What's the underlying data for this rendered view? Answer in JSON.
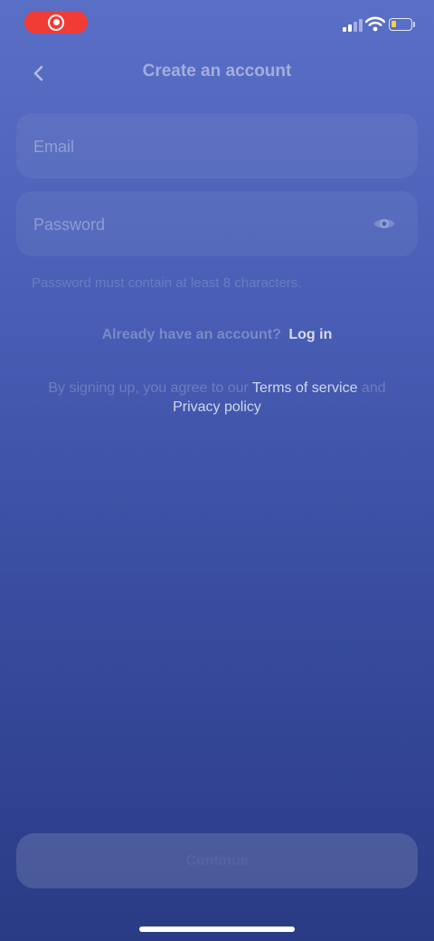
{
  "status_bar": {
    "recording_icon": "screen-record-icon",
    "signal_icon": "cellular-signal-icon",
    "wifi_icon": "wifi-icon",
    "battery_icon": "battery-icon",
    "battery_level": 0.2,
    "colors": {
      "record": "#f03c34",
      "battery_fill": "#f6d33e"
    }
  },
  "header": {
    "back_icon": "chevron-left-icon",
    "title": "Create an account"
  },
  "form": {
    "email": {
      "value": "",
      "placeholder": "Email"
    },
    "password": {
      "value": "",
      "placeholder": "Password",
      "toggle_icon": "eye-icon"
    },
    "hint": "Password must contain at least 8 characters."
  },
  "login": {
    "question": "Already have an account?",
    "link": "Log in"
  },
  "terms": {
    "prefix": "By signing up, you agree to our",
    "terms_link": "Terms of service",
    "conjunction": "and",
    "privacy_link": "Privacy policy"
  },
  "footer": {
    "submit_label": "Continue"
  },
  "colors": {
    "gradient_top": "#5a6fc6",
    "gradient_bottom": "#2a3b85"
  }
}
